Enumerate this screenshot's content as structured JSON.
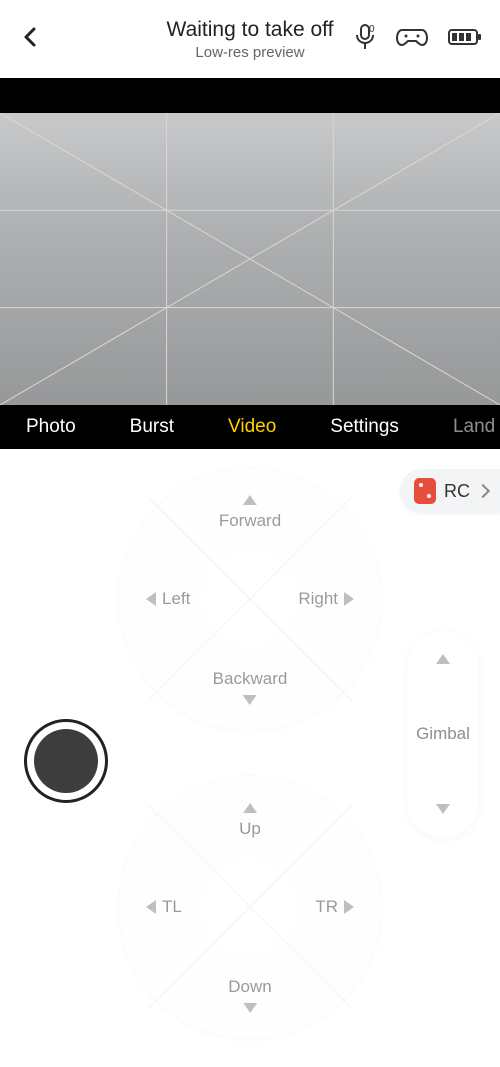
{
  "header": {
    "title": "Waiting to take off",
    "subtitle": "Low-res preview"
  },
  "modes": {
    "photo": "Photo",
    "burst": "Burst",
    "video": "Video",
    "settings": "Settings",
    "land": "Land"
  },
  "rc": {
    "label": "RC"
  },
  "stick1": {
    "up": "Forward",
    "down": "Backward",
    "left": "Left",
    "right": "Right"
  },
  "stick2": {
    "up": "Up",
    "down": "Down",
    "left": "TL",
    "right": "TR"
  },
  "gimbal": {
    "label": "Gimbal"
  }
}
